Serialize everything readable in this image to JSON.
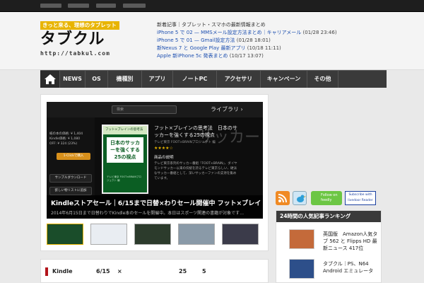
{
  "header": {
    "logo_tagline": "きっと来る、理想のタブレット",
    "logo_name": "タブクル",
    "logo_url": "http://tabkul.com",
    "news_heading": "新着記事｜タブレット・スマホの最新情報まとめ",
    "news": [
      {
        "title": "iPhone 5 で 02 — MMSメール設定方法まとめ｜キャリアメール",
        "time": "(01/28 23:46)"
      },
      {
        "title": "iPhone 5 で 01 — Gmail設定方法",
        "time": "(01/28 18:01)"
      },
      {
        "title": "新Nexus 7 と Google Play 最新アプリ",
        "time": "(10/18 11:11)"
      },
      {
        "title": "Apple 新iPhone 5c 発表まとめ",
        "time": "(10/17 13:07)"
      }
    ]
  },
  "nav": {
    "home_icon": "home-icon",
    "items": [
      "NEWS",
      "OS",
      "機種別",
      "アプリ",
      "ノートPC",
      "アクセサリ",
      "キャンペーン",
      "その他"
    ]
  },
  "slider": {
    "search_placeholder": "検索",
    "library_label": "ライブラリ",
    "price_lines": [
      "紙の本の価格: ¥ 1,404",
      "Kindle価格: ¥ 1,080",
      "OFF: ¥ 324 (23%)"
    ],
    "buy_label": "1-Clickで購入",
    "sample_label": "サンプルダウンロード",
    "wishlist_label": "欲しい物リストに追加",
    "cover_top": "フット×ブレインの思考法",
    "cover_title": "日本のサッカーを強くする25の視点",
    "cover_bottom": "テレビ東京 FOOT×BRAINプロジェクト 編",
    "book_title": "フット×ブレインの思考法　日本のサッカーを強くする25の視点",
    "book_publisher": "テレビ東京 FOOT×BRAINプロジェクト 編",
    "book_stars": "★★★★☆",
    "book_desc_head": "商品の説明",
    "book_desc": "テレビ東京系列のサッカー番組『FOOT×BRAIN』、ダイヤモンドサッカー以来の伝統を誇るテレビ東京らしい、硬派なサッカー番組として、深いサッカーファンの支持を集めています。",
    "ghost_text": "サッカー",
    "caption_title": "Kindleストアセール｜6/15まで日替×わりセール開催中 フット×ブレインの思考法が25%オフの5冊",
    "caption_sub": "2014年6月15日まで日替わりでKindle本のセールを開催中。本日はスポーツ関連の書籍が対象です…"
  },
  "article_list": {
    "first_row": [
      "Kindle",
      "6/15",
      "×",
      "25",
      "5"
    ]
  },
  "social": {
    "rss_icon": "rss-icon",
    "twitter_icon": "twitter-bird-icon",
    "follow_label": "Follow on feedly",
    "livedoor_label": "Subscribe with livedoor Reader"
  },
  "ranking": {
    "heading": "24時間の人気記事ランキング",
    "items": [
      {
        "title": "英国版　Amazon人気タブ 562 と Flipps HD 最新ニュース 417位"
      },
      {
        "title": "タブクル｜PS、N64 Android エミュレータ"
      }
    ]
  },
  "colors": {
    "topbar": "#1e1e1e",
    "nav": "#3a3a3a",
    "news_link": "#1d4fb0",
    "logo_yellow": "#e8b400",
    "accent_red": "#b3141b",
    "feedly_green": "#6cc644"
  }
}
